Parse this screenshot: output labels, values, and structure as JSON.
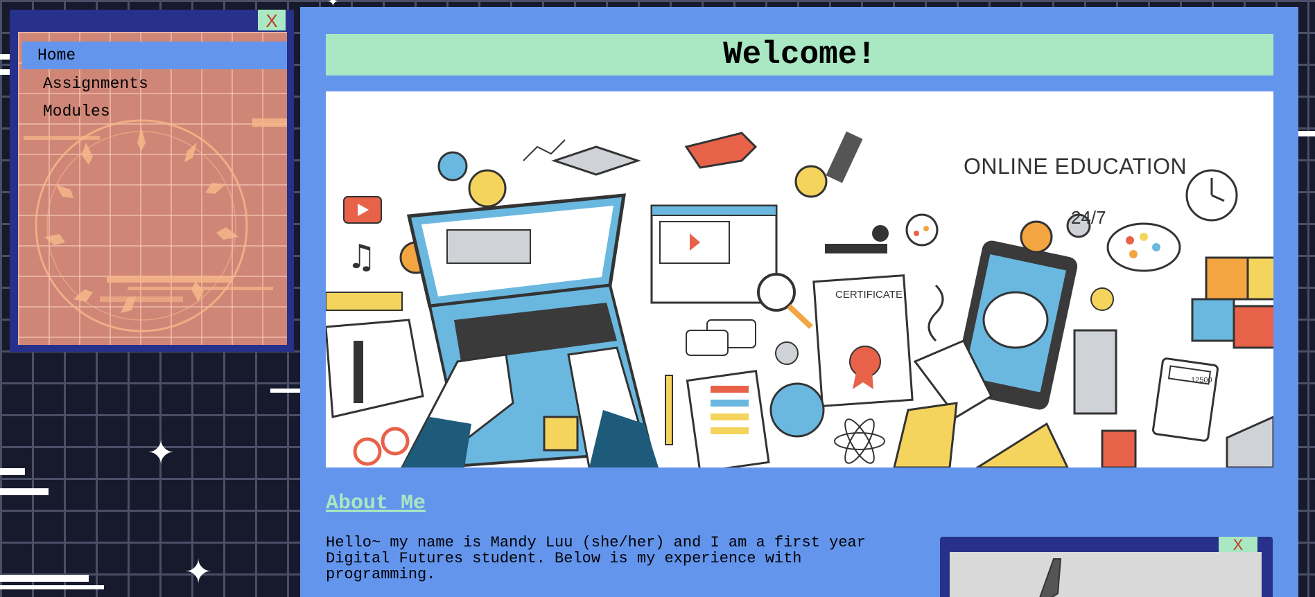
{
  "nav": {
    "close_label": "X",
    "items": [
      {
        "label": "Home",
        "active": true
      },
      {
        "label": "Assignments",
        "active": false
      },
      {
        "label": "Modules",
        "active": false
      }
    ]
  },
  "main": {
    "title": "Welcome!",
    "hero": {
      "caption": "ONLINE EDUCATION",
      "badge_247": "24/7",
      "certificate_label": "CERTIFICATE",
      "calculator_display": "12500"
    },
    "about": {
      "heading": "About Me",
      "text": "Hello~ my name is Mandy Luu (she/her) and I am a first year Digital Futures student. Below is my experience with programming."
    },
    "sub_window": {
      "close_label": "X"
    }
  },
  "colors": {
    "background": "#171a2c",
    "grid": "#4a4e66",
    "window_frame": "#27308a",
    "nav_panel": "#cf8677",
    "accent_blue": "#6495ed",
    "mint": "#a9e8c2",
    "close_x": "#c0392b"
  }
}
